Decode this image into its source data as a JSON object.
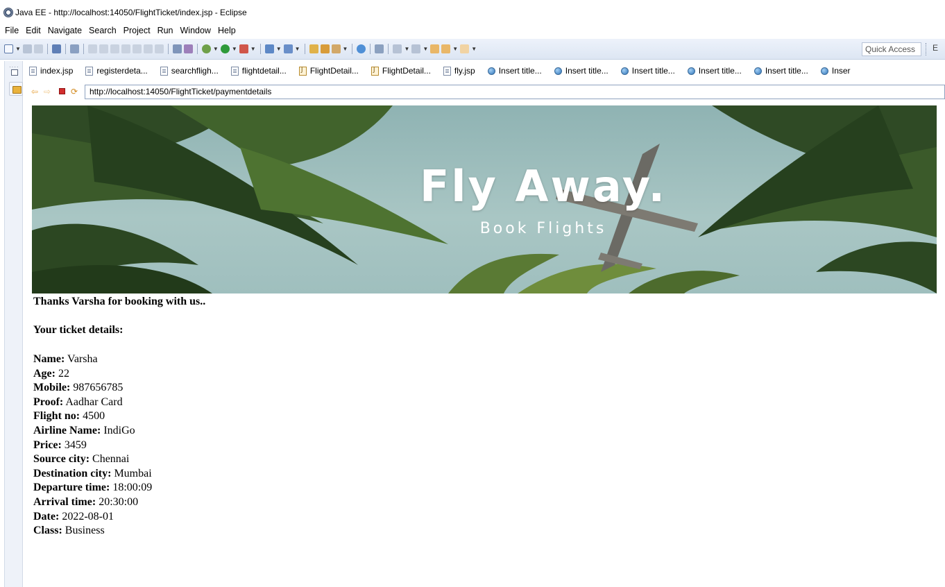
{
  "window": {
    "title": "Java EE - http://localhost:14050/FlightTicket/index.jsp - Eclipse"
  },
  "menubar": {
    "items": [
      "File",
      "Edit",
      "Navigate",
      "Search",
      "Project",
      "Run",
      "Window",
      "Help"
    ]
  },
  "toolbar": {
    "quick_access_placeholder": "Quick Access",
    "perspective_label": "E"
  },
  "editor_tabs": [
    {
      "label": "index.jsp",
      "icon": "jsp-file-icon"
    },
    {
      "label": "registerdeta...",
      "icon": "jsp-file-icon"
    },
    {
      "label": "searchfligh...",
      "icon": "jsp-file-icon"
    },
    {
      "label": "flightdetail...",
      "icon": "jsp-file-icon"
    },
    {
      "label": "FlightDetail...",
      "icon": "java-file-icon"
    },
    {
      "label": "FlightDetail...",
      "icon": "java-file-icon"
    },
    {
      "label": "fly.jsp",
      "icon": "jsp-file-icon"
    },
    {
      "label": "Insert title...",
      "icon": "globe-icon"
    },
    {
      "label": "Insert title...",
      "icon": "globe-icon"
    },
    {
      "label": "Insert title...",
      "icon": "globe-icon"
    },
    {
      "label": "Insert title...",
      "icon": "globe-icon"
    },
    {
      "label": "Insert title...",
      "icon": "globe-icon"
    },
    {
      "label": "Inser",
      "icon": "globe-icon"
    }
  ],
  "browser": {
    "url": "http://localhost:14050/FlightTicket/paymentdetails"
  },
  "page": {
    "banner": {
      "title": "Fly Away.",
      "subtitle": "Book Flights"
    },
    "thanks": "Thanks Varsha for booking with us..",
    "ticket_heading": "Your ticket details:",
    "details": [
      {
        "label": "Name:",
        "value": "Varsha"
      },
      {
        "label": "Age:",
        "value": "22"
      },
      {
        "label": "Mobile:",
        "value": "987656785"
      },
      {
        "label": "Proof:",
        "value": "Aadhar Card"
      },
      {
        "label": "Flight no:",
        "value": "4500"
      },
      {
        "label": "Airline Name:",
        "value": "IndiGo"
      },
      {
        "label": "Price:",
        "value": "3459"
      },
      {
        "label": "Source city:",
        "value": "Chennai"
      },
      {
        "label": "Destination city:",
        "value": "Mumbai"
      },
      {
        "label": "Departure time:",
        "value": "18:00:09"
      },
      {
        "label": "Arrival time:",
        "value": "20:30:00"
      },
      {
        "label": "Date:",
        "value": "2022-08-01"
      },
      {
        "label": "Class:",
        "value": "Business"
      }
    ]
  }
}
